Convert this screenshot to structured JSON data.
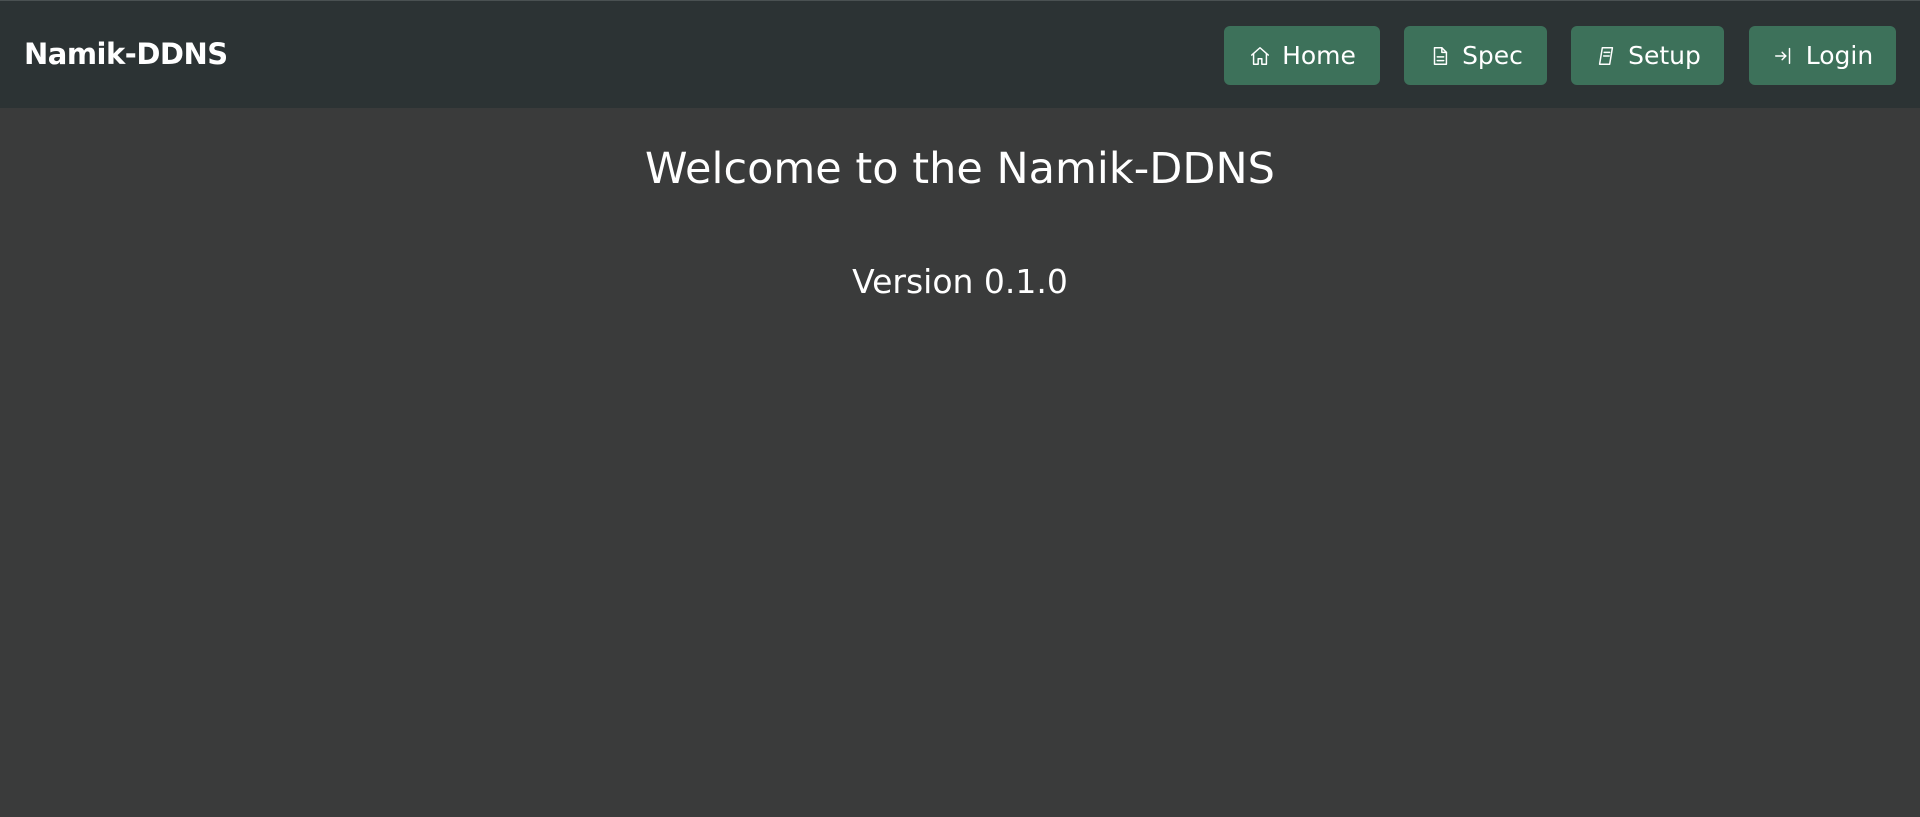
{
  "brand": "Namik-DDNS",
  "nav": {
    "home": {
      "label": "Home",
      "icon": "home-icon"
    },
    "spec": {
      "label": "Spec",
      "icon": "document-icon"
    },
    "setup": {
      "label": "Setup",
      "icon": "notebook-icon"
    },
    "login": {
      "label": "Login",
      "icon": "login-icon"
    }
  },
  "main": {
    "title": "Welcome to the Namik-DDNS",
    "version": "Version 0.1.0"
  },
  "colors": {
    "background": "#3a3b3b",
    "navbar": "#2c3334",
    "button": "#3d715a",
    "text": "#ffffff"
  }
}
